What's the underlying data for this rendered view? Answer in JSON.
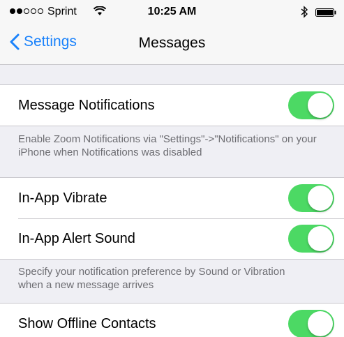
{
  "status_bar": {
    "carrier": "Sprint",
    "time": "10:25 AM",
    "signal_full": 2,
    "signal_total": 5
  },
  "nav": {
    "back_label": "Settings",
    "title": "Messages"
  },
  "settings": {
    "message_notifications": {
      "label": "Message Notifications",
      "on": true
    },
    "notifications_footer": "Enable Zoom Notifications via \"Settings\"->\"Notifications\" on your iPhone when Notifications was disabled",
    "in_app_vibrate": {
      "label": "In-App Vibrate",
      "on": true
    },
    "in_app_alert_sound": {
      "label": "In-App Alert Sound",
      "on": true
    },
    "preference_footer": "Specify your notification preference by Sound or Vibration when a new message arrives",
    "show_offline_contacts": {
      "label": "Show Offline Contacts",
      "on": true
    }
  },
  "colors": {
    "accent": "#1a82fb",
    "toggle_on": "#4cd964",
    "background": "#efeff4"
  }
}
